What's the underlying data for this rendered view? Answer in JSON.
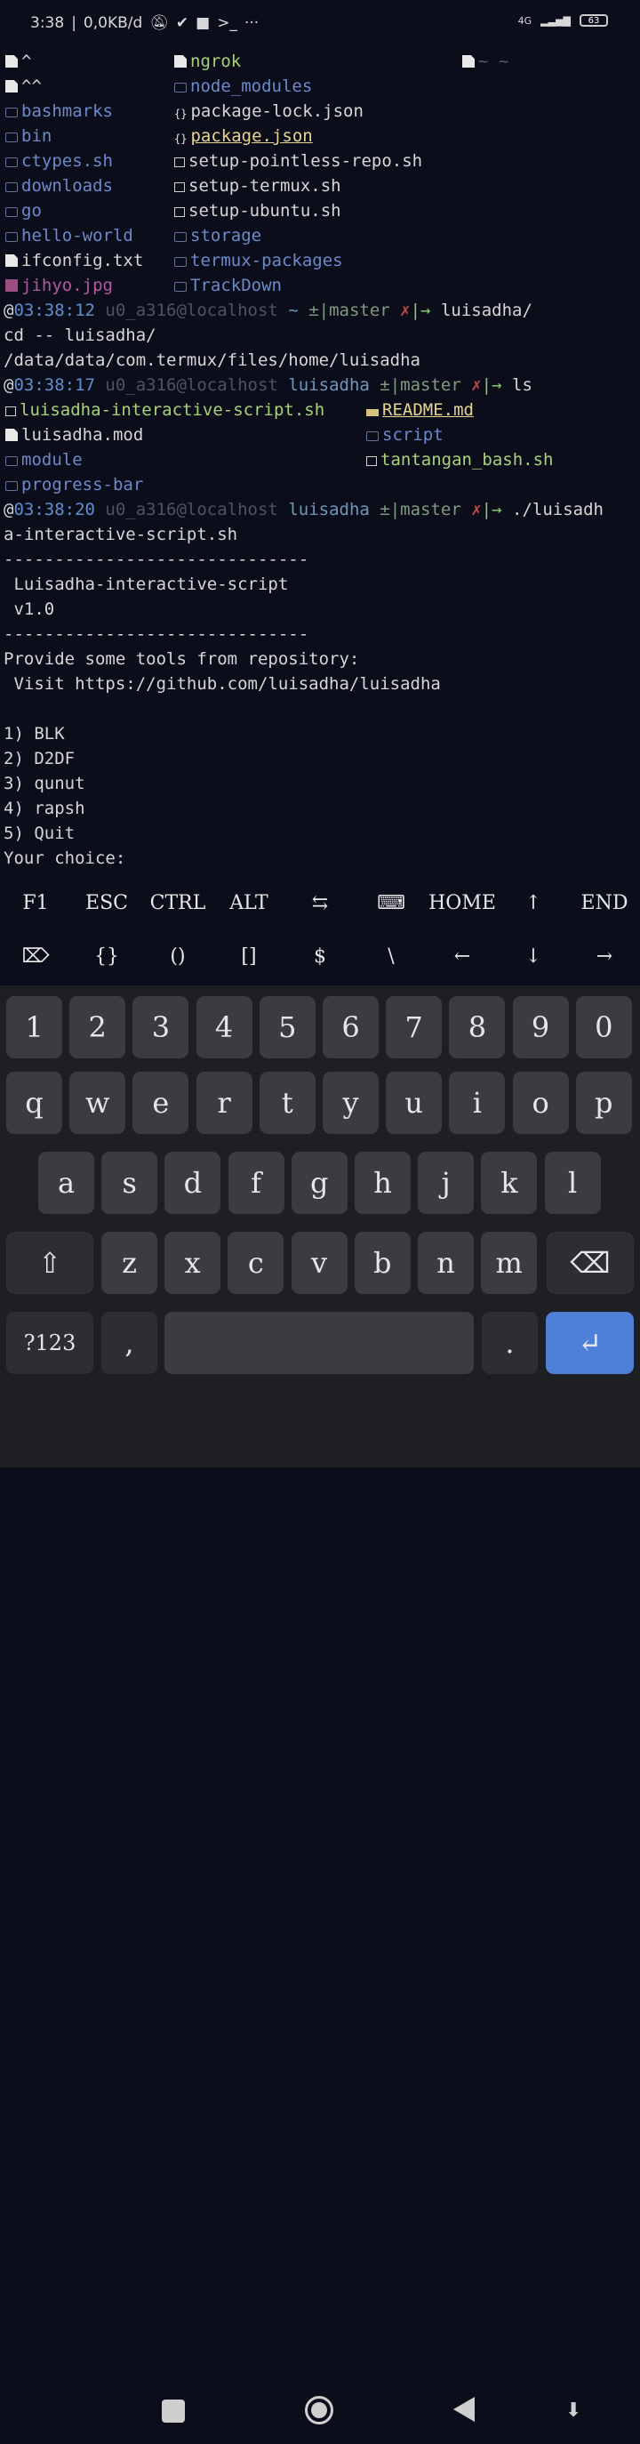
{
  "status_bar": {
    "time": "3:38",
    "speed": "0,0KB/d",
    "network": "4G",
    "battery": "63",
    "notification_icons": [
      "mute-icon",
      "check-icon",
      "camera-icon",
      "terminal-prompt-icon",
      "more-dots-icon"
    ]
  },
  "ls_home": {
    "col1": [
      {
        "icon": "file",
        "name": "^",
        "type": "file"
      },
      {
        "icon": "file",
        "name": "^^",
        "type": "file"
      },
      {
        "icon": "folder",
        "name": "bashmarks",
        "type": "dir"
      },
      {
        "icon": "folder",
        "name": "bin",
        "type": "dir"
      },
      {
        "icon": "folder",
        "name": "ctypes.sh",
        "type": "dir"
      },
      {
        "icon": "folder",
        "name": "downloads",
        "type": "dir"
      },
      {
        "icon": "folder",
        "name": "go",
        "type": "dir"
      },
      {
        "icon": "folder",
        "name": "hello-world",
        "type": "dir"
      },
      {
        "icon": "file",
        "name": "ifconfig.txt",
        "type": "file"
      },
      {
        "icon": "image",
        "name": "jihyo.jpg",
        "type": "image"
      }
    ],
    "col2": [
      {
        "icon": "file",
        "name": "ngrok",
        "type": "exec"
      },
      {
        "icon": "node",
        "name": "node_modules",
        "type": "dir"
      },
      {
        "icon": "json",
        "name": "package-lock.json",
        "type": "file"
      },
      {
        "icon": "json",
        "name": "package.json",
        "type": "json"
      },
      {
        "icon": "sh",
        "name": "setup-pointless-repo.sh",
        "type": "file"
      },
      {
        "icon": "sh",
        "name": "setup-termux.sh",
        "type": "file"
      },
      {
        "icon": "sh",
        "name": "setup-ubuntu.sh",
        "type": "file"
      },
      {
        "icon": "folder",
        "name": "storage",
        "type": "dir"
      },
      {
        "icon": "folder",
        "name": "termux-packages",
        "type": "dir"
      },
      {
        "icon": "folder",
        "name": "TrackDown",
        "type": "dir"
      }
    ],
    "col3": [
      {
        "icon": "file",
        "name": "~ ~",
        "type": "dim"
      }
    ]
  },
  "prompts": [
    {
      "at": "@",
      "time": "03:38:12",
      "user": " u0_a316@localhost",
      "cwd": " ~",
      "git": " ±|master",
      "x": " ✗",
      "arrow": "|→",
      "cmd": " luisadha/"
    },
    {
      "at": "@",
      "time": "03:38:17",
      "user": " u0_a316@localhost",
      "cwd": " luisadha",
      "git": " ±|master",
      "x": " ✗",
      "arrow": "|→",
      "cmd": " ls"
    },
    {
      "at": "@",
      "time": "03:38:20",
      "user": " u0_a316@localhost",
      "cwd": " luisadha",
      "git": " ±|master",
      "x": " ✗",
      "arrow": "|→",
      "cmd": " ./luisadh"
    }
  ],
  "cd_output": [
    "cd -- luisadha/",
    "/data/data/com.termux/files/home/luisadha"
  ],
  "ls_luisadha": {
    "col1": [
      {
        "icon": "sh",
        "name": "luisadha-interactive-script.sh",
        "type": "exec"
      },
      {
        "icon": "file",
        "name": "luisadha.mod",
        "type": "file"
      },
      {
        "icon": "folder",
        "name": "module",
        "type": "dir"
      },
      {
        "icon": "folder",
        "name": "progress-bar",
        "type": "dir"
      }
    ],
    "col2": [
      {
        "icon": "md",
        "name": "README.md",
        "type": "json"
      },
      {
        "icon": "folder",
        "name": "script",
        "type": "dir"
      },
      {
        "icon": "sh",
        "name": "tantangan_bash.sh",
        "type": "exec"
      }
    ]
  },
  "script_output": [
    "a-interactive-script.sh",
    "------------------------------",
    " Luisadha-interactive-script",
    " v1.0",
    "------------------------------",
    "Provide some tools from repository:",
    " Visit https://github.com/luisadha/luisadha",
    "",
    "1) BLK",
    "2) D2DF",
    "3) qunut",
    "4) rapsh",
    "5) Quit",
    "Your choice:"
  ],
  "extra_keys": {
    "row1": [
      "F1",
      "ESC",
      "CTRL",
      "ALT",
      "⇆",
      "⌨",
      "HOME",
      "↑",
      "END"
    ],
    "row2": [
      "⌦",
      "{}",
      "()",
      "[]",
      "$",
      "\\",
      "←",
      "↓",
      "→"
    ]
  },
  "keyboard": {
    "numbers": [
      "1",
      "2",
      "3",
      "4",
      "5",
      "6",
      "7",
      "8",
      "9",
      "0"
    ],
    "row1": [
      "q",
      "w",
      "e",
      "r",
      "t",
      "y",
      "u",
      "i",
      "o",
      "p"
    ],
    "row2": [
      "a",
      "s",
      "d",
      "f",
      "g",
      "h",
      "j",
      "k",
      "l"
    ],
    "row3": [
      "z",
      "x",
      "c",
      "v",
      "b",
      "n",
      "m"
    ],
    "shift": "⇧",
    "backspace": "⌫",
    "symbols": "?123",
    "comma": ",",
    "period": ".",
    "enter": "↵"
  }
}
